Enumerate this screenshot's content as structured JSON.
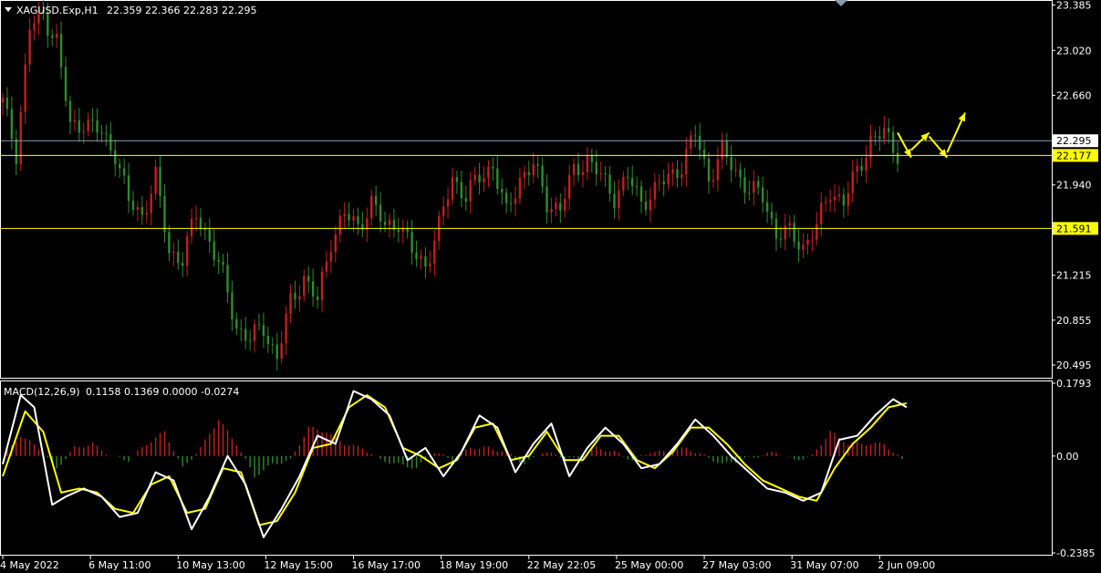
{
  "symbol_header": {
    "symbol": "XAGUSD.Exp,H1",
    "ohlc": "22.359 22.366 22.283 22.295"
  },
  "macd_header": {
    "name": "MACD(12,26,9)",
    "values": "0.1158 0.1369 0.0000 -0.0274"
  },
  "colors": {
    "background": "#000000",
    "bull": "#c21f1f",
    "bear": "#2e8b2e",
    "price_line": "#8a9bb0",
    "level_line": "#ffff00",
    "macd_line": "#ffffff",
    "signal_line": "#ffff00",
    "arrow": "#ffff00"
  },
  "chart_data": [
    {
      "type": "candlestick",
      "name": "price",
      "ylim": [
        20.4,
        23.41
      ],
      "yticks": [
        "23.385",
        "23.020",
        "22.660",
        "22.295",
        "21.940",
        "21.215",
        "20.855",
        "20.495"
      ],
      "ytick_values": [
        23.385,
        23.02,
        22.66,
        22.295,
        21.94,
        21.215,
        20.855,
        20.495
      ],
      "current_price": 22.295,
      "current_price_label": "22.295",
      "levels": [
        {
          "value": 22.177,
          "label": "22.177"
        },
        {
          "value": 21.591,
          "label": "21.591"
        }
      ],
      "close_path": [
        [
          0,
          22.6
        ],
        [
          3,
          22.2
        ],
        [
          6,
          23.2
        ],
        [
          9,
          23.3
        ],
        [
          12,
          23.1
        ],
        [
          15,
          22.4
        ],
        [
          18,
          22.45
        ],
        [
          22,
          22.35
        ],
        [
          25,
          22.2
        ],
        [
          28,
          21.8
        ],
        [
          31,
          21.7
        ],
        [
          34,
          22.0
        ],
        [
          37,
          21.4
        ],
        [
          40,
          21.35
        ],
        [
          43,
          21.7
        ],
        [
          46,
          21.5
        ],
        [
          49,
          21.2
        ],
        [
          52,
          20.8
        ],
        [
          55,
          20.7
        ],
        [
          58,
          20.8
        ],
        [
          61,
          20.55
        ],
        [
          64,
          21.0
        ],
        [
          67,
          21.2
        ],
        [
          70,
          21.0
        ],
        [
          73,
          21.5
        ],
        [
          76,
          21.7
        ],
        [
          79,
          21.6
        ],
        [
          82,
          21.8
        ],
        [
          85,
          21.6
        ],
        [
          88,
          21.65
        ],
        [
          91,
          21.4
        ],
        [
          94,
          21.3
        ],
        [
          97,
          21.6
        ],
        [
          100,
          22.0
        ],
        [
          103,
          21.85
        ],
        [
          106,
          22.0
        ],
        [
          109,
          22.1
        ],
        [
          112,
          21.7
        ],
        [
          115,
          22.0
        ],
        [
          118,
          22.1
        ],
        [
          121,
          21.8
        ],
        [
          124,
          21.75
        ],
        [
          127,
          22.05
        ],
        [
          130,
          22.15
        ],
        [
          133,
          22.0
        ],
        [
          136,
          21.85
        ],
        [
          139,
          22.0
        ],
        [
          142,
          21.8
        ],
        [
          145,
          21.9
        ],
        [
          148,
          22.0
        ],
        [
          151,
          22.1
        ],
        [
          154,
          22.35
        ],
        [
          157,
          22.0
        ],
        [
          160,
          22.2
        ],
        [
          163,
          22.05
        ],
        [
          166,
          21.9
        ],
        [
          169,
          21.85
        ],
        [
          172,
          21.55
        ],
        [
          175,
          21.55
        ],
        [
          178,
          21.45
        ],
        [
          181,
          21.6
        ],
        [
          184,
          21.9
        ],
        [
          187,
          21.8
        ],
        [
          190,
          22.05
        ],
        [
          193,
          22.3
        ],
        [
          196,
          22.35
        ],
        [
          199,
          22.2
        ]
      ],
      "future_arrows": [
        [
          [
            199,
            22.36
          ],
          [
            202,
            22.16
          ]
        ],
        [
          [
            202,
            22.22
          ],
          [
            206,
            22.36
          ]
        ],
        [
          [
            206,
            22.33
          ],
          [
            210,
            22.16
          ]
        ],
        [
          [
            210,
            22.2
          ],
          [
            214,
            22.52
          ]
        ]
      ],
      "xticks": [
        "4 May 2022",
        "6 May 11:00",
        "10 May 13:00",
        "12 May 15:00",
        "16 May 17:00",
        "18 May 19:00",
        "22 May 22:05",
        "25 May 00:00",
        "27 May 03:00",
        "31 May 07:00",
        "2 Jun 09:00"
      ],
      "xtick_index": [
        0,
        19.5,
        39,
        58.5,
        78,
        97.5,
        117,
        136.5,
        156,
        175.5,
        195
      ]
    },
    {
      "type": "macd",
      "name": "MACD(12,26,9)",
      "ylim": [
        -0.2385,
        0.1793
      ],
      "yticks": [
        "0.1793",
        "0.00",
        "-0.2385"
      ],
      "ytick_values": [
        0.1793,
        0.0,
        -0.2385
      ],
      "macd_path": [
        [
          0,
          -0.02
        ],
        [
          4,
          0.15
        ],
        [
          7,
          0.12
        ],
        [
          11,
          -0.12
        ],
        [
          14,
          -0.1
        ],
        [
          18,
          -0.08
        ],
        [
          22,
          -0.1
        ],
        [
          26,
          -0.15
        ],
        [
          30,
          -0.14
        ],
        [
          34,
          -0.04
        ],
        [
          38,
          -0.06
        ],
        [
          42,
          -0.18
        ],
        [
          46,
          -0.1
        ],
        [
          50,
          0.0
        ],
        [
          54,
          -0.07
        ],
        [
          58,
          -0.2
        ],
        [
          62,
          -0.13
        ],
        [
          66,
          -0.05
        ],
        [
          70,
          0.05
        ],
        [
          74,
          0.03
        ],
        [
          78,
          0.16
        ],
        [
          82,
          0.14
        ],
        [
          86,
          0.1
        ],
        [
          90,
          -0.01
        ],
        [
          94,
          0.02
        ],
        [
          98,
          -0.05
        ],
        [
          102,
          0.01
        ],
        [
          106,
          0.1
        ],
        [
          110,
          0.07
        ],
        [
          114,
          -0.04
        ],
        [
          118,
          0.03
        ],
        [
          122,
          0.08
        ],
        [
          126,
          -0.05
        ],
        [
          130,
          0.02
        ],
        [
          134,
          0.07
        ],
        [
          138,
          0.03
        ],
        [
          142,
          -0.03
        ],
        [
          146,
          -0.02
        ],
        [
          150,
          0.03
        ],
        [
          154,
          0.09
        ],
        [
          158,
          0.05
        ],
        [
          162,
          0.0
        ],
        [
          166,
          -0.04
        ],
        [
          170,
          -0.08
        ],
        [
          174,
          -0.09
        ],
        [
          178,
          -0.11
        ],
        [
          182,
          -0.09
        ],
        [
          186,
          0.04
        ],
        [
          190,
          0.05
        ],
        [
          194,
          0.1
        ],
        [
          198,
          0.14
        ],
        [
          201,
          0.12
        ]
      ],
      "signal_path": [
        [
          0,
          -0.05
        ],
        [
          5,
          0.11
        ],
        [
          9,
          0.06
        ],
        [
          13,
          -0.09
        ],
        [
          17,
          -0.08
        ],
        [
          21,
          -0.09
        ],
        [
          25,
          -0.13
        ],
        [
          29,
          -0.14
        ],
        [
          33,
          -0.07
        ],
        [
          37,
          -0.05
        ],
        [
          41,
          -0.14
        ],
        [
          45,
          -0.13
        ],
        [
          49,
          -0.03
        ],
        [
          53,
          -0.04
        ],
        [
          57,
          -0.17
        ],
        [
          61,
          -0.16
        ],
        [
          65,
          -0.09
        ],
        [
          69,
          0.02
        ],
        [
          73,
          0.03
        ],
        [
          77,
          0.12
        ],
        [
          81,
          0.15
        ],
        [
          85,
          0.12
        ],
        [
          89,
          0.02
        ],
        [
          93,
          0.0
        ],
        [
          97,
          -0.03
        ],
        [
          101,
          -0.01
        ],
        [
          105,
          0.07
        ],
        [
          109,
          0.08
        ],
        [
          113,
          -0.01
        ],
        [
          117,
          0.0
        ],
        [
          121,
          0.06
        ],
        [
          125,
          -0.01
        ],
        [
          129,
          -0.01
        ],
        [
          133,
          0.05
        ],
        [
          137,
          0.05
        ],
        [
          141,
          -0.01
        ],
        [
          145,
          -0.03
        ],
        [
          149,
          0.01
        ],
        [
          153,
          0.07
        ],
        [
          157,
          0.07
        ],
        [
          161,
          0.03
        ],
        [
          165,
          -0.02
        ],
        [
          169,
          -0.06
        ],
        [
          173,
          -0.08
        ],
        [
          177,
          -0.1
        ],
        [
          181,
          -0.11
        ],
        [
          185,
          -0.03
        ],
        [
          189,
          0.03
        ],
        [
          193,
          0.07
        ],
        [
          197,
          0.12
        ],
        [
          201,
          0.13
        ]
      ],
      "histogram_path": [
        [
          0,
          0.0
        ],
        [
          4,
          0.05
        ],
        [
          8,
          0.02
        ],
        [
          12,
          -0.03
        ],
        [
          16,
          0.02
        ],
        [
          20,
          0.03
        ],
        [
          24,
          0.0
        ],
        [
          28,
          -0.01
        ],
        [
          32,
          0.03
        ],
        [
          36,
          0.06
        ],
        [
          40,
          -0.03
        ],
        [
          44,
          0.02
        ],
        [
          48,
          0.09
        ],
        [
          52,
          0.03
        ],
        [
          56,
          -0.05
        ],
        [
          60,
          -0.02
        ],
        [
          64,
          -0.01
        ],
        [
          68,
          0.07
        ],
        [
          72,
          0.06
        ],
        [
          76,
          0.03
        ],
        [
          80,
          0.02
        ],
        [
          84,
          -0.01
        ],
        [
          88,
          -0.02
        ],
        [
          92,
          -0.03
        ],
        [
          96,
          0.01
        ],
        [
          100,
          -0.01
        ],
        [
          104,
          0.02
        ],
        [
          108,
          0.02
        ],
        [
          112,
          0.01
        ],
        [
          116,
          -0.02
        ],
        [
          120,
          0.01
        ],
        [
          124,
          0.0
        ],
        [
          128,
          -0.01
        ],
        [
          132,
          0.02
        ],
        [
          136,
          0.01
        ],
        [
          140,
          -0.01
        ],
        [
          144,
          0.01
        ],
        [
          148,
          0.01
        ],
        [
          152,
          0.02
        ],
        [
          156,
          0.0
        ],
        [
          160,
          -0.02
        ],
        [
          164,
          -0.01
        ],
        [
          168,
          0.0
        ],
        [
          172,
          0.01
        ],
        [
          176,
          -0.01
        ],
        [
          180,
          0.0
        ],
        [
          184,
          0.06
        ],
        [
          188,
          0.03
        ],
        [
          192,
          0.03
        ],
        [
          196,
          0.03
        ],
        [
          200,
          -0.01
        ]
      ]
    }
  ]
}
